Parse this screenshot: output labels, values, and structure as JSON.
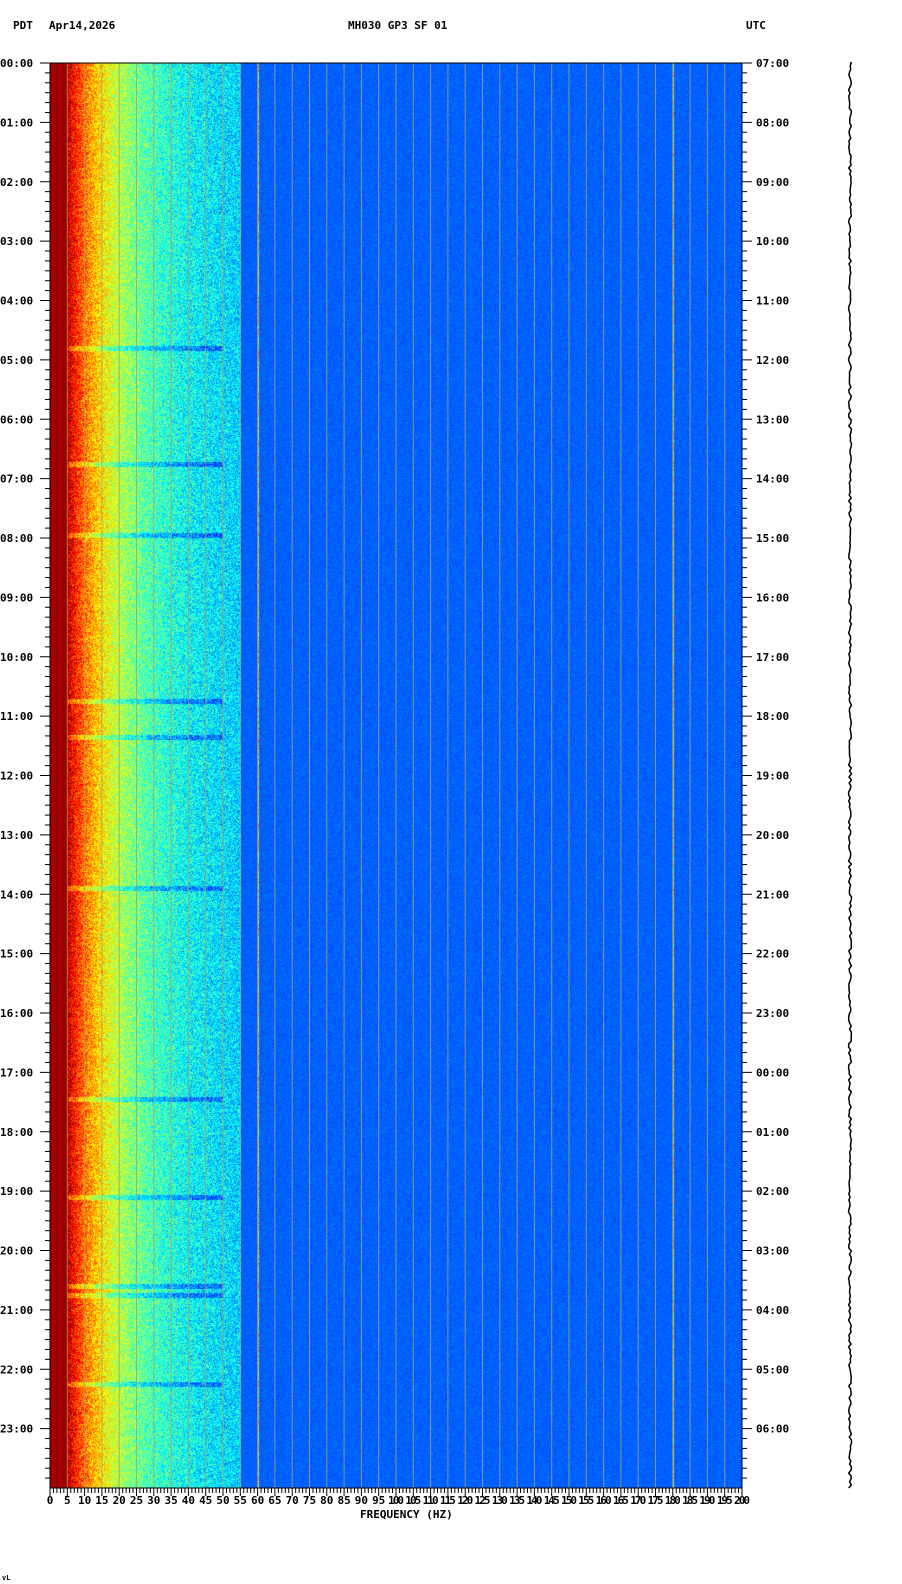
{
  "header": {
    "timezone_left": "PDT",
    "date": "Apr14,2026",
    "station": "MH030 GP3 SF 01",
    "timezone_right": "UTC"
  },
  "chart_data": {
    "type": "heatmap",
    "title": "MH030 GP3 SF 01",
    "xlabel": "FREQUENCY (HZ)",
    "ylabel_left": "PDT",
    "ylabel_right": "UTC",
    "xlim": [
      0,
      200
    ],
    "ylim_hours": [
      0,
      24
    ],
    "x_ticks": [
      "0",
      "5",
      "10",
      "15",
      "20",
      "25",
      "30",
      "35",
      "40",
      "45",
      "50",
      "55",
      "60",
      "65",
      "70",
      "75",
      "80",
      "85",
      "90",
      "95",
      "100",
      "105",
      "110",
      "115",
      "120",
      "125",
      "130",
      "135",
      "140",
      "145",
      "150",
      "155",
      "160",
      "165",
      "170",
      "175",
      "180",
      "185",
      "190",
      "195",
      "200"
    ],
    "y_ticks_left": [
      "00:00",
      "01:00",
      "02:00",
      "03:00",
      "04:00",
      "05:00",
      "06:00",
      "07:00",
      "08:00",
      "09:00",
      "10:00",
      "11:00",
      "12:00",
      "13:00",
      "14:00",
      "15:00",
      "16:00",
      "17:00",
      "18:00",
      "19:00",
      "20:00",
      "21:00",
      "22:00",
      "23:00"
    ],
    "y_ticks_right": [
      "07:00",
      "08:00",
      "09:00",
      "10:00",
      "11:00",
      "12:00",
      "13:00",
      "14:00",
      "15:00",
      "16:00",
      "17:00",
      "18:00",
      "19:00",
      "20:00",
      "21:00",
      "22:00",
      "23:00",
      "00:00",
      "01:00",
      "02:00",
      "03:00",
      "04:00",
      "05:00",
      "06:00"
    ],
    "spectral_lines_hz": [
      60,
      180
    ],
    "event_hours": [
      4.8,
      6.75,
      7.95,
      10.75,
      11.35,
      13.9,
      17.45,
      19.1,
      20.6,
      20.75,
      22.25
    ],
    "colormap": "jet",
    "colors": {
      "background": "#0000c0",
      "low_freq": "#800000",
      "grid": "#b0a060"
    }
  },
  "footer_mark": "vL"
}
